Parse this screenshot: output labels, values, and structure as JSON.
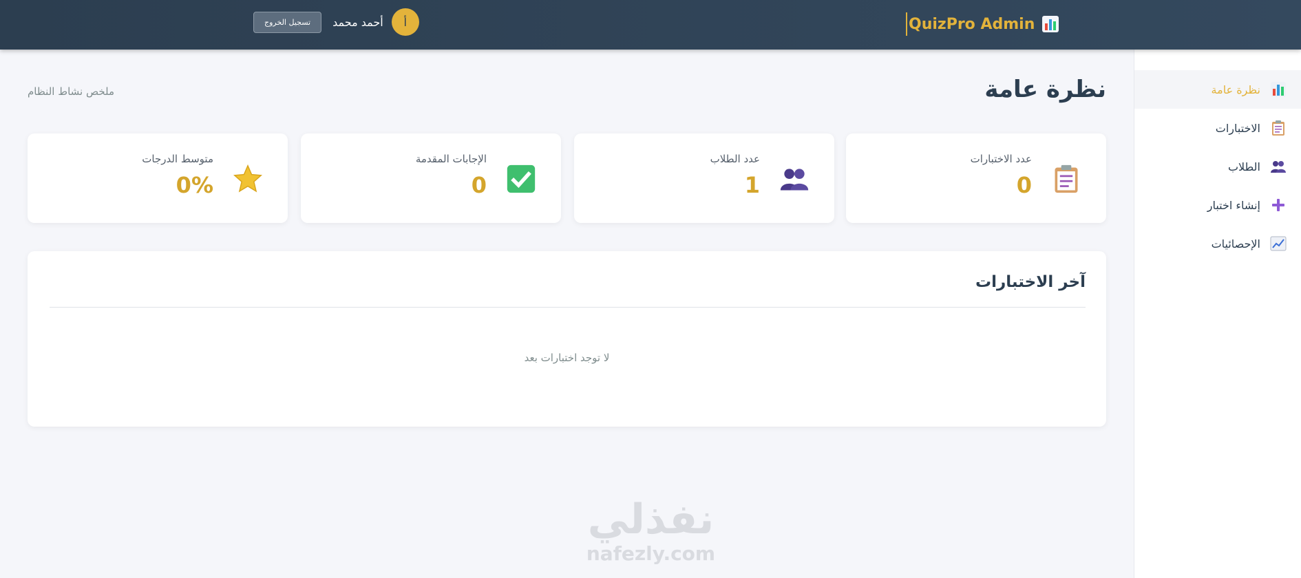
{
  "header": {
    "brand": "QuizPro Admin",
    "brand_icon": "bar-chart-icon",
    "user_name": "أحمد محمد",
    "avatar_initial": "أ",
    "logout_label": "تسجيل الخروج"
  },
  "sidebar": {
    "items": [
      {
        "label": "نظرة عامة",
        "icon": "bar-chart-icon",
        "active": true
      },
      {
        "label": "الاختبارات",
        "icon": "clipboard-icon",
        "active": false
      },
      {
        "label": "الطلاب",
        "icon": "users-icon",
        "active": false
      },
      {
        "label": "إنشاء اختبار",
        "icon": "plus-icon",
        "active": false
      },
      {
        "label": "الإحصائيات",
        "icon": "trend-chart-icon",
        "active": false
      }
    ]
  },
  "main": {
    "title": "نظرة عامة",
    "subtitle": "ملخص نشاط النظام",
    "stats": [
      {
        "label": "عدد الاختبارات",
        "value": "0",
        "icon": "clipboard-icon"
      },
      {
        "label": "عدد الطلاب",
        "value": "1",
        "icon": "users-icon"
      },
      {
        "label": "الإجابات المقدمة",
        "value": "0",
        "icon": "check-box-icon"
      },
      {
        "label": "متوسط الدرجات",
        "value": "0%",
        "icon": "star-icon"
      }
    ],
    "recent": {
      "title": "آخر الاختبارات",
      "empty_message": "لا توجد اختبارات بعد"
    }
  },
  "watermark": {
    "arabic": "نفذلي",
    "latin": "nafezly.com"
  },
  "colors": {
    "header_bg": "#2c3e50",
    "accent": "#e3b33b",
    "value": "#d4a52c",
    "page_bg": "#f5f6fa"
  }
}
